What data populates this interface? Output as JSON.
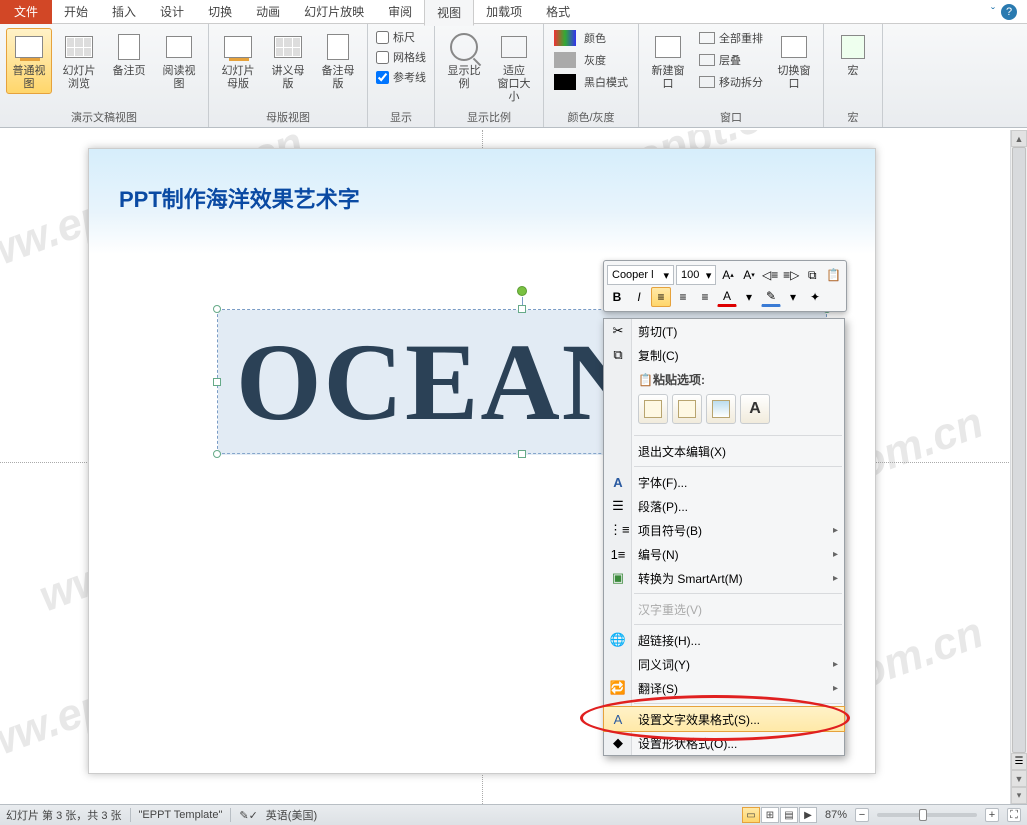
{
  "tabs": {
    "file": "文件",
    "items": [
      "开始",
      "插入",
      "设计",
      "切换",
      "动画",
      "幻灯片放映",
      "审阅",
      "视图",
      "加载项",
      "格式"
    ],
    "active": "视图"
  },
  "ribbon": {
    "presViews": {
      "label": "演示文稿视图",
      "normal": "普通视图",
      "sorter": "幻灯片浏览",
      "notes": "备注页",
      "reading": "阅读视图"
    },
    "masterViews": {
      "label": "母版视图",
      "slide": "幻灯片母版",
      "handout": "讲义母版",
      "notes": "备注母版"
    },
    "show": {
      "label": "显示",
      "ruler": "标尺",
      "grid": "网格线",
      "guides": "参考线"
    },
    "zoom": {
      "label": "显示比例",
      "zoom": "显示比例",
      "fit": "适应\n窗口大小"
    },
    "color": {
      "label": "颜色/灰度",
      "color": "颜色",
      "gray": "灰度",
      "bw": "黑白模式"
    },
    "window": {
      "label": "窗口",
      "new": "新建窗口",
      "all": "全部重排",
      "cascade": "层叠",
      "split": "移动拆分",
      "switch": "切换窗口"
    },
    "macros": {
      "label": "宏",
      "btn": "宏"
    }
  },
  "slide": {
    "title": "PPT制作海洋效果艺术字",
    "text": "OCEAN"
  },
  "miniToolbar": {
    "font": "Cooper l",
    "size": "100"
  },
  "contextMenu": {
    "cut": "剪切(T)",
    "copy": "复制(C)",
    "pasteLabel": "粘贴选项:",
    "exit": "退出文本编辑(X)",
    "font": "字体(F)...",
    "para": "段落(P)...",
    "bullets": "项目符号(B)",
    "numbering": "编号(N)",
    "smartart": "转换为 SmartArt(M)",
    "reconvert": "汉字重选(V)",
    "hyperlink": "超链接(H)...",
    "synonym": "同义词(Y)",
    "translate": "翻译(S)",
    "textfx": "设置文字效果格式(S)...",
    "shapefmt": "设置形状格式(O)..."
  },
  "statusbar": {
    "slideinfo": "幻灯片 第 3 张，共 3 张",
    "template": "\"EPPT Template\"",
    "lang": "英语(美国)",
    "zoom": "87%"
  },
  "watermark": "www.eppt.com.cn"
}
